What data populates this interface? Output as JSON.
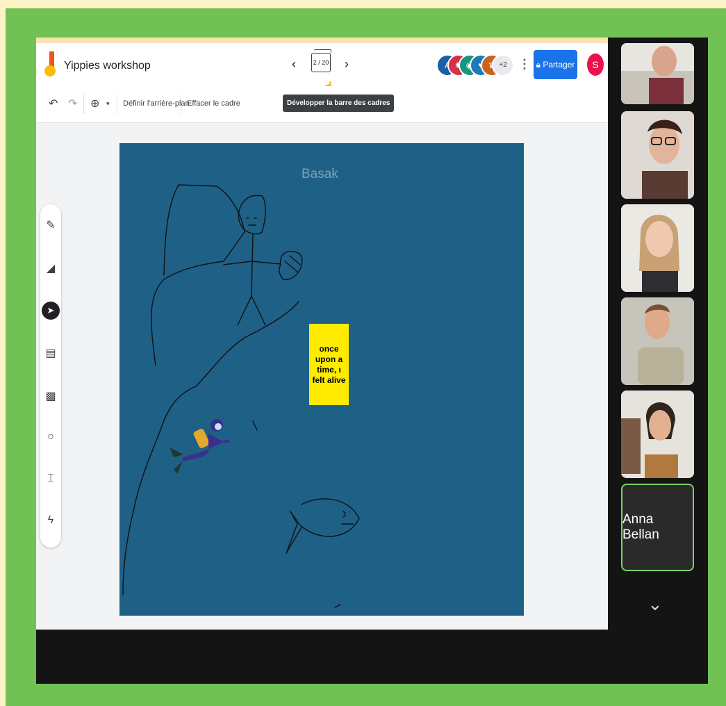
{
  "app": {
    "title": "Yippies workshop",
    "frame_counter": "2 / 20",
    "tooltip": "Développer la barre des cadres",
    "avatars": [
      "A",
      "+2"
    ],
    "share_label": "Partager",
    "user_initial": "S"
  },
  "toolbar": {
    "background_label": "Définir l'arrière-plan",
    "clear_label": "Effacer le cadre"
  },
  "canvas": {
    "title": "Basak",
    "sticky_note": "once\nupon a\ntime, ı\nfelt alive"
  },
  "participants": {
    "name_tile": "Anna Bellan"
  },
  "colors": {
    "canvas_bg": "#1f6087",
    "sticky": "#ffeb00",
    "share_button": "#1a73e8",
    "frame_green": "#71c155"
  }
}
